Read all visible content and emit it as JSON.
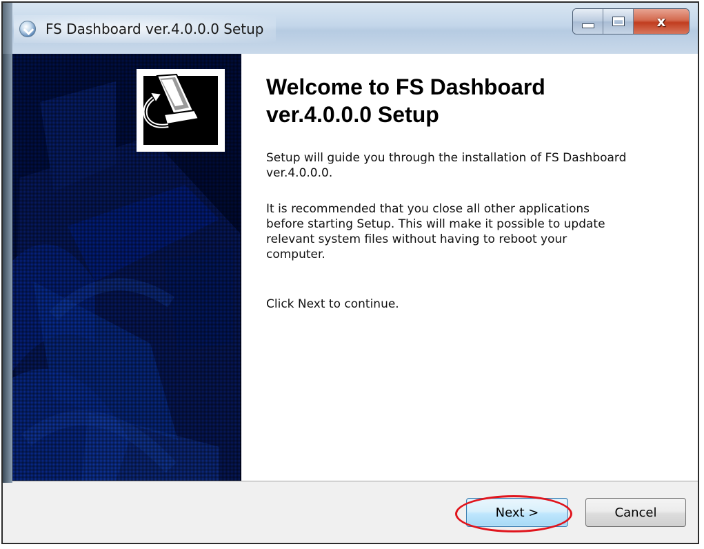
{
  "window": {
    "title": "FS Dashboard ver.4.0.0.0 Setup",
    "caption_buttons": {
      "minimize_icon": "minimize-icon",
      "maximize_icon": "maximize-icon",
      "close_label": "x"
    }
  },
  "banner": {
    "logo_icon": "installer-computer-icon",
    "background_color": "#000c4a"
  },
  "content": {
    "title": "Welcome to FS Dashboard ver.4.0.0.0 Setup",
    "paragraph1": "Setup will guide you through the installation of FS Dashboard\nver.4.0.0.0.",
    "paragraph2": "It is recommended that you close all other applications\nbefore starting Setup. This will make it possible to update\nrelevant system files without having to reboot your\ncomputer.",
    "paragraph3": "Click Next to continue."
  },
  "footer": {
    "next_label": "Next >",
    "cancel_label": "Cancel"
  },
  "colors": {
    "highlight_ring": "#e0141c",
    "next_border": "#3c7fb1"
  }
}
